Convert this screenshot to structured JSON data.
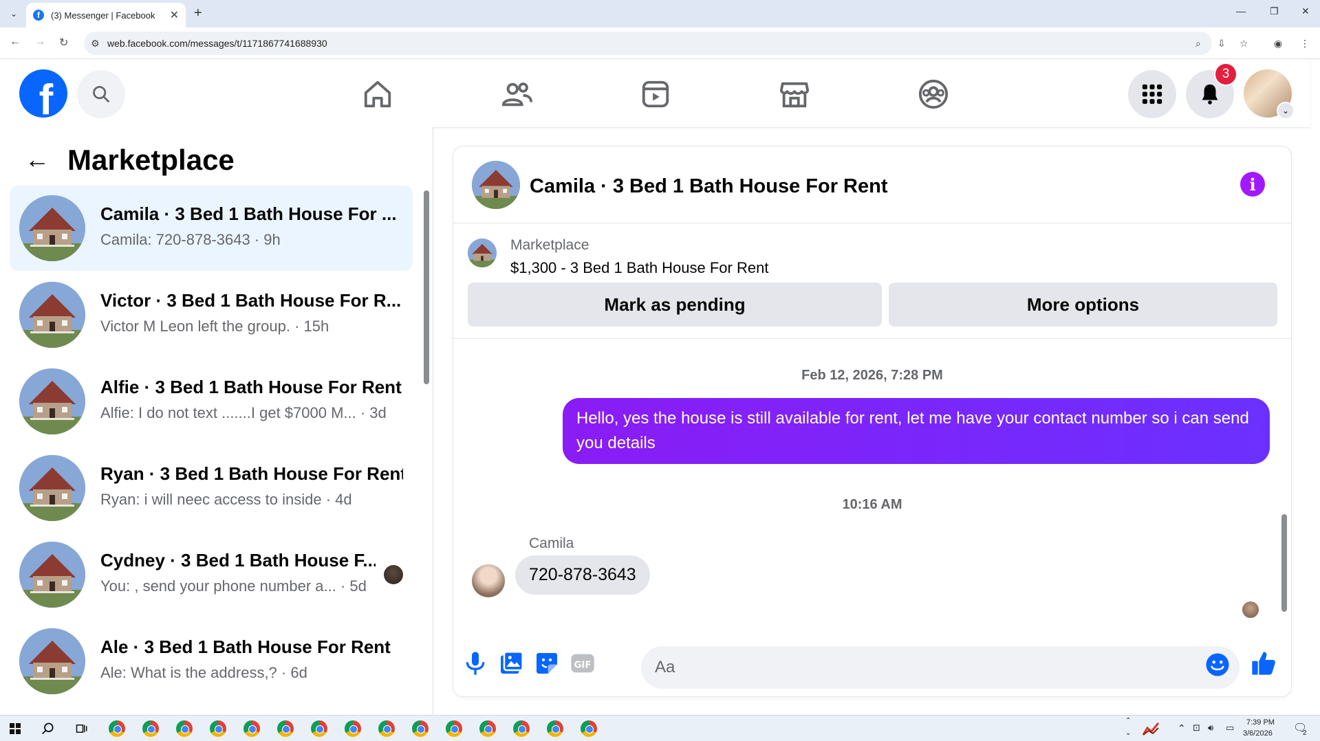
{
  "browser": {
    "tab_title": "(3) Messenger | Facebook",
    "url": "web.facebook.com/messages/t/1171867741688930"
  },
  "header": {
    "notification_count": "3"
  },
  "sidebar": {
    "title": "Marketplace",
    "conversations": [
      {
        "name": "Camila · 3 Bed 1 Bath House For ...",
        "preview": "Camila: 720-878-3643 · 9h",
        "active": true
      },
      {
        "name": "Victor · 3 Bed 1 Bath House For R...",
        "preview": "Victor M Leon left the group. · 15h"
      },
      {
        "name": "Alfie · 3 Bed 1 Bath House For Rent",
        "preview": "Alfie: I do not text .......I get $7000 M...  · 3d"
      },
      {
        "name": "Ryan · 3 Bed 1 Bath House For Rent",
        "preview": "Ryan: i will neec access to inside · 4d"
      },
      {
        "name": "Cydney · 3 Bed 1 Bath House F...",
        "preview": "You: , send your phone number a...  · 5d"
      },
      {
        "name": "Ale · 3 Bed 1 Bath House For Rent",
        "preview": "Ale: What is the address,? · 6d"
      }
    ]
  },
  "chat": {
    "title": "Camila · 3 Bed 1 Bath House For Rent",
    "listing_label": "Marketplace",
    "listing_price": "$1,300 - 3 Bed 1 Bath House For Rent",
    "mark_pending_label": "Mark as pending",
    "more_options_label": "More options",
    "timestamp_1": "Feb 12, 2026, 7:28 PM",
    "outgoing_message": "Hello, yes the house is still available for rent, let me have your contact number so i can send you  details",
    "timestamp_2": "10:16 AM",
    "sender_name": "Camila",
    "incoming_message": "720-878-3643",
    "composer_placeholder": "Aa"
  },
  "taskbar": {
    "time": "7:39 PM",
    "date": "3/6/2026",
    "notifications": "2"
  },
  "colors": {
    "brand": "#0866ff",
    "message_purple": "#7b2cf9",
    "info_purple": "#a218ff",
    "badge_red": "#e41e3f"
  }
}
